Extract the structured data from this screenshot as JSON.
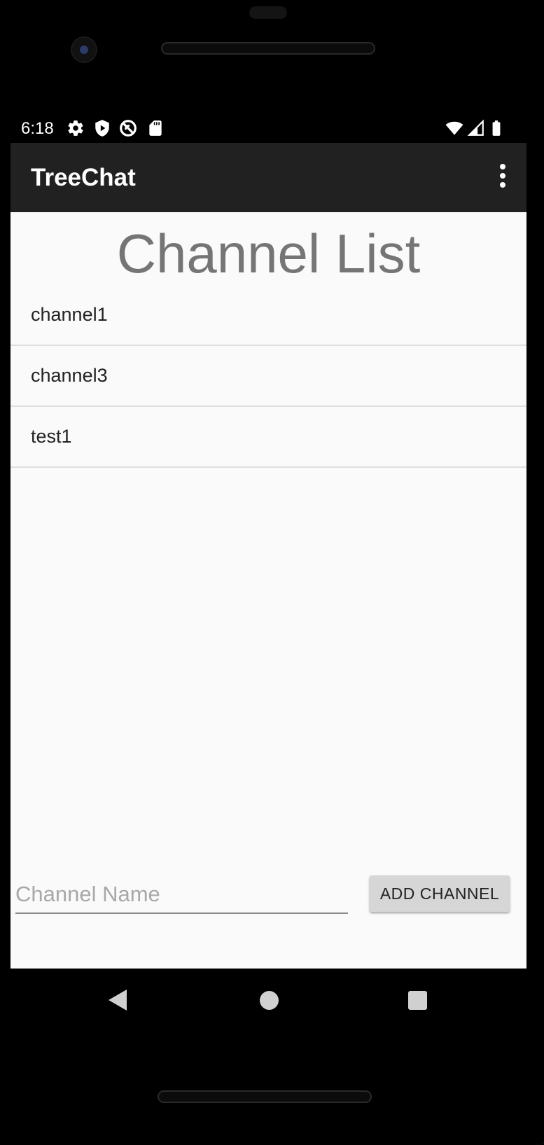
{
  "status_bar": {
    "time": "6:18",
    "left_icons": [
      "settings-icon",
      "shield-play-icon",
      "no-signal-circle-icon",
      "sd-card-icon"
    ],
    "right_icons": [
      "wifi-icon",
      "cell-signal-icon",
      "battery-icon"
    ]
  },
  "app_bar": {
    "title": "TreeChat",
    "menu_icon": "more-vert-icon"
  },
  "main": {
    "heading": "Channel List",
    "channels": [
      {
        "label": "channel1"
      },
      {
        "label": "channel3"
      },
      {
        "label": "test1"
      }
    ],
    "channel_name_input": {
      "value": "",
      "placeholder": "Channel Name"
    },
    "add_button_label": "ADD CHANNEL"
  },
  "nav_bar": {
    "icons": [
      "back-icon",
      "home-icon",
      "recents-icon"
    ]
  },
  "colors": {
    "app_bar": "#212121",
    "background": "#fafafa",
    "heading": "#757575",
    "button": "#d6d6d6"
  }
}
